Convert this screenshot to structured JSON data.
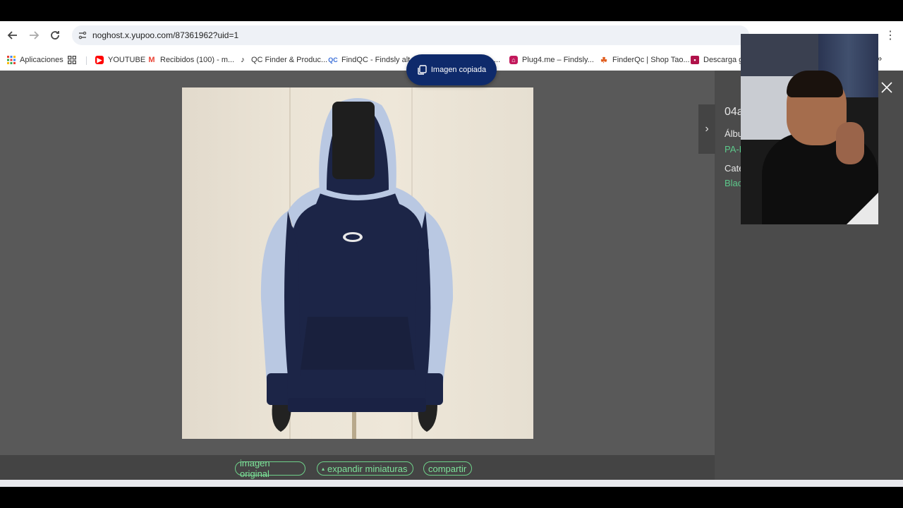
{
  "browser": {
    "url": "noghost.x.yupoo.com/87361962?uid=1",
    "bookmarks": [
      {
        "label": "Aplicaciones",
        "icon": "apps-grid-icon",
        "color": "#ea4335"
      },
      {
        "label": "",
        "icon": "grid-icon",
        "color": "#555555"
      },
      {
        "label": "YOUTUBE",
        "icon": "youtube-icon",
        "color": "#ff0000"
      },
      {
        "label": "Recibidos (100) - m...",
        "icon": "gmail-icon",
        "color": "#ea4335"
      },
      {
        "label": "QC Finder & Produc...",
        "icon": "tiktok-icon",
        "color": "#111111"
      },
      {
        "label": "FindQC - Findsly alt...",
        "icon": "findqc-icon",
        "color": "#3b6fd8"
      },
      {
        "label": "...",
        "icon": "bookmark-icon",
        "color": "#888888"
      },
      {
        "label": "Plug4.me – Findsly...",
        "icon": "plug4-icon",
        "color": "#c2185b"
      },
      {
        "label": "FinderQc | Shop Tao...",
        "icon": "finderqc-icon",
        "color": "#e05a1a"
      },
      {
        "label": "Descarga gr",
        "icon": "download-icon",
        "color": "#b0124a"
      }
    ],
    "more": "»"
  },
  "toast": {
    "text": "Imagen copiada"
  },
  "viewer": {
    "buttons": {
      "original": "imagen original",
      "expand": "expandir miniaturas",
      "expand_prefix": "▴",
      "share": "compartir"
    },
    "next_arrow": "›"
  },
  "sidebar": {
    "title": "04a",
    "album_label": "Álbu",
    "album_value": "PA-L",
    "category_label": "Cate",
    "category_value": "Blac"
  },
  "colors": {
    "accent_green": "#7ee39a",
    "toast_bg": "#0e2a6b",
    "hoodie_navy": "#1c2547",
    "hoodie_light": "#b9c8e2"
  }
}
